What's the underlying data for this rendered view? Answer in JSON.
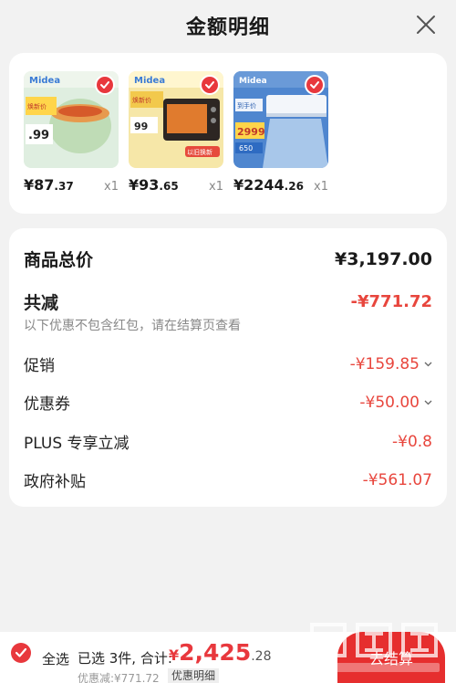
{
  "header": {
    "title": "金额明细"
  },
  "products": [
    {
      "name": "midea-cooker",
      "price_int": "¥87",
      "price_dec": ".37",
      "qty": "x1",
      "colors": [
        "#cfe3c5",
        "#e8a05a"
      ]
    },
    {
      "name": "midea-oven",
      "price_int": "¥93",
      "price_dec": ".65",
      "qty": "x1",
      "colors": [
        "#f2c25a",
        "#3a2a22"
      ]
    },
    {
      "name": "midea-aircon",
      "price_int": "¥2244",
      "price_dec": ".26",
      "qty": "x1",
      "colors": [
        "#5b93d6",
        "#eaf2fb"
      ]
    }
  ],
  "thumb_text": {
    "brand": "Midea",
    "p1_tag": "焕新价",
    "p1_price": ".99",
    "p2_tag": "焕新价",
    "p2_price": "99",
    "p2_badge": "以旧换新",
    "p3_top": "到手价",
    "p3_price": "2999",
    "p3_sub": "650"
  },
  "summary": {
    "total_label": "商品总价",
    "total_value": "¥3,197.00",
    "reduce_label": "共减",
    "reduce_value": "-¥771.72",
    "note": "以下优惠不包含红包，请在结算页查看",
    "items": [
      {
        "label": "促销",
        "value": "-¥159.85",
        "chev": true
      },
      {
        "label": "优惠券",
        "value": "-¥50.00",
        "chev": true
      },
      {
        "label": "PLUS 专享立减",
        "value": "-¥0.8",
        "chev": false
      },
      {
        "label": "政府补贴",
        "value": "-¥561.07",
        "chev": false
      }
    ]
  },
  "bottom": {
    "all_label": "全选",
    "selected_text": "已选 3件, 合计:",
    "price_cur": "¥",
    "price_int": "2,425",
    "price_dec": ".28",
    "discount_text": "优惠减:¥771.72",
    "detail_label": "优惠明细",
    "checkout_label": "去结算"
  },
  "colors": {
    "accent": "#e8383d",
    "text": "#1a1a1a",
    "muted": "#888888",
    "bg": "#f2f2f2"
  }
}
